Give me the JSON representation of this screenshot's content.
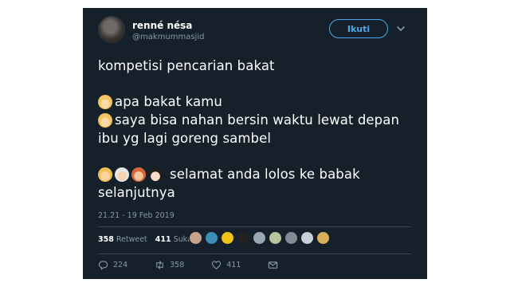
{
  "tweet": {
    "display_name": "renné nésa",
    "handle": "@makmummasjid",
    "follow_label": "Ikuti",
    "lines": {
      "l1": "kompetisi pencarian bakat",
      "l2": "apa bakat kamu",
      "l3": "saya bisa nahan bersin waktu lewat depan",
      "l4": "ibu yg lagi goreng sambel",
      "l5": "selamat anda lolos ke babak",
      "l6": "selanjutnya"
    },
    "timestamp": "21.21 - 19 Feb 2019",
    "stats": {
      "retweets_count": "358",
      "retweets_label": "Retweet",
      "likes_count": "411",
      "likes_label": "Suka"
    },
    "actions": {
      "reply_count": "224",
      "retweet_count": "358",
      "like_count": "411"
    }
  },
  "colors": {
    "background": "#15202b",
    "accent": "#4aa8e8",
    "muted": "#8899a6",
    "divider": "#38444d"
  },
  "icons": [
    "chevron-down-icon",
    "reply-icon",
    "retweet-icon",
    "heart-icon",
    "message-icon"
  ]
}
